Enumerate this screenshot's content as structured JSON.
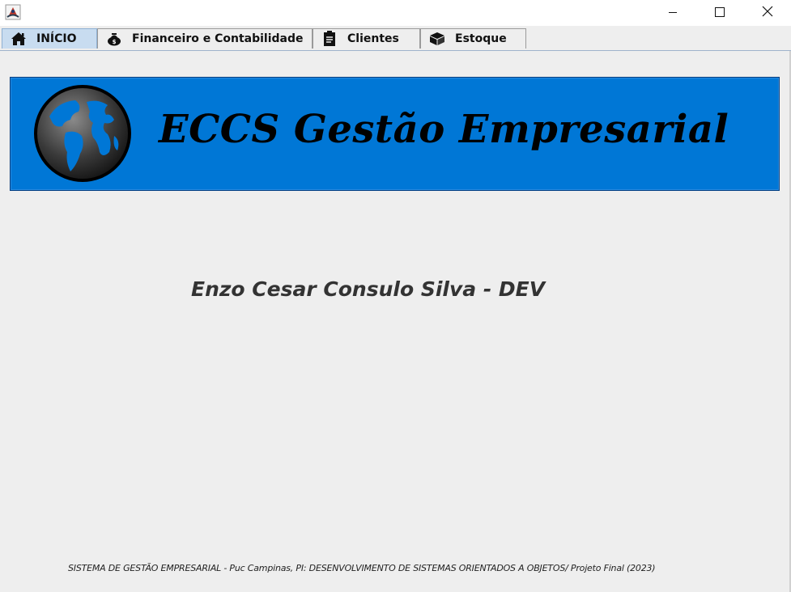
{
  "titlebar": {
    "app_icon": "java-app-icon",
    "controls": {
      "minimize_icon": "minimize-icon",
      "maximize_icon": "maximize-icon",
      "close_icon": "close-icon"
    }
  },
  "tabs": [
    {
      "label": "INÍCIO",
      "icon": "home-icon",
      "active": true
    },
    {
      "label": "Financeiro e Contabilidade",
      "icon": "money-bag-icon",
      "active": false
    },
    {
      "label": "Clientes",
      "icon": "clipboard-icon",
      "active": false
    },
    {
      "label": "Estoque",
      "icon": "box-icon",
      "active": false
    }
  ],
  "banner": {
    "title": "ECCS Gestão Empresarial",
    "icon": "globe-icon",
    "background_color": "#0077d6"
  },
  "main": {
    "developer": "Enzo Cesar Consulo Silva - DEV"
  },
  "footer": {
    "text": "SISTEMA DE GESTÃO EMPRESARIAL - Puc Campinas, PI: DESENVOLVIMENTO DE SISTEMAS ORIENTADOS A OBJETOS/ Projeto Final (2023)"
  }
}
